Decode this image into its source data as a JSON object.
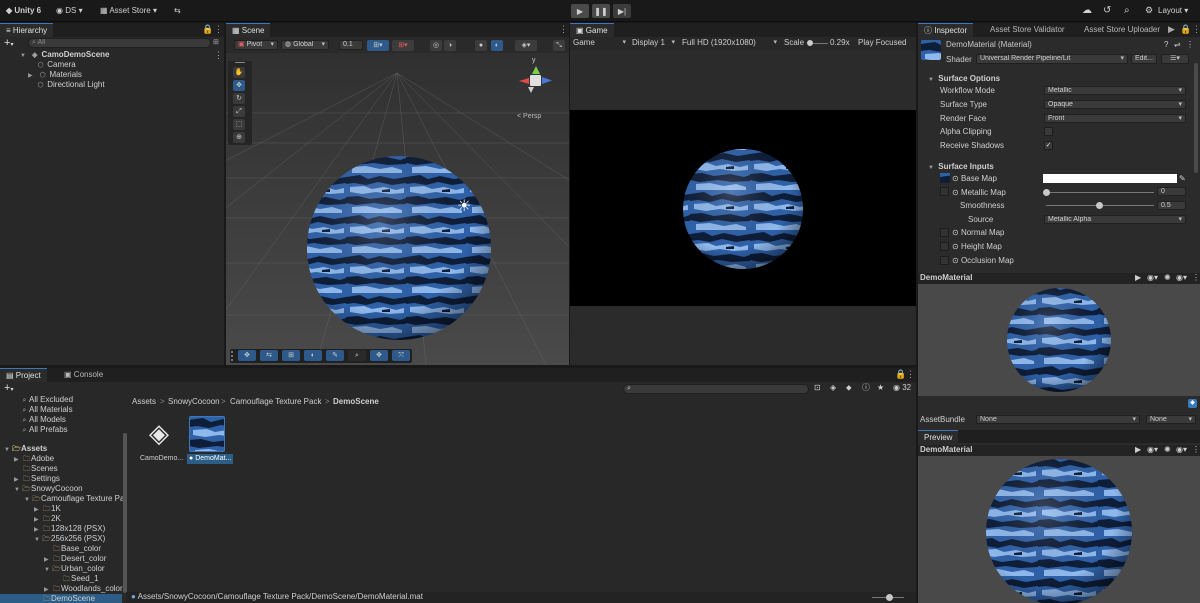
{
  "toolbar": {
    "app": "Unity 6",
    "account": "DS",
    "asset_store": "Asset Store",
    "layout": "Layout"
  },
  "hierarchy": {
    "tab": "Hierarchy",
    "search_placeholder": "All",
    "scene": "CamoDemoScene",
    "items": [
      "Camera",
      "Materials",
      "Directional Light"
    ]
  },
  "scene_view": {
    "tab": "Scene",
    "pivot": "Pivot",
    "global": "Global",
    "snap": "0.1",
    "persp": "< Persp",
    "gizmo_y": "y"
  },
  "game_view": {
    "tab": "Game",
    "mode": "Game",
    "display": "Display 1",
    "resolution": "Full HD (1920x1080)",
    "scale_label": "Scale",
    "scale_value": "0.29x",
    "play_focused": "Play Focused"
  },
  "inspector": {
    "tabs": [
      "Inspector",
      "Asset Store Validator",
      "Asset Store Uploader"
    ],
    "material_name": "DemoMaterial (Material)",
    "shader_label": "Shader",
    "shader_value": "Universal Render Pipeline/Lit",
    "edit_button": "Edit...",
    "surface_options": "Surface Options",
    "workflow_mode_label": "Workflow Mode",
    "workflow_mode_value": "Metallic",
    "surface_type_label": "Surface Type",
    "surface_type_value": "Opaque",
    "render_face_label": "Render Face",
    "render_face_value": "Front",
    "alpha_clipping_label": "Alpha Clipping",
    "receive_shadows_label": "Receive Shadows",
    "surface_inputs": "Surface Inputs",
    "base_map": "Base Map",
    "metallic_map": "Metallic Map",
    "metallic_value": "0",
    "smoothness": "Smoothness",
    "smoothness_value": "0.5",
    "source": "Source",
    "source_value": "Metallic Alpha",
    "normal_map": "Normal Map",
    "height_map": "Height Map",
    "occlusion_map": "Occlusion Map",
    "preview_header": "DemoMaterial",
    "assetbundle_label": "AssetBundle",
    "assetbundle_value": "None",
    "assetbundle_variant": "None",
    "preview_tab": "Preview",
    "preview_title": "DemoMaterial"
  },
  "project": {
    "tabs": [
      "Project",
      "Console"
    ],
    "count": "32",
    "favorites": [
      "All Excluded",
      "All Materials",
      "All Models",
      "All Prefabs"
    ],
    "tree": [
      {
        "label": "Assets",
        "level": 0,
        "open": true,
        "bold": true
      },
      {
        "label": "Adobe",
        "level": 1,
        "open": false
      },
      {
        "label": "Scenes",
        "level": 1,
        "open": null
      },
      {
        "label": "Settings",
        "level": 1,
        "open": false
      },
      {
        "label": "SnowyCocoon",
        "level": 1,
        "open": true
      },
      {
        "label": "Camouflage Texture Pa",
        "level": 2,
        "open": true
      },
      {
        "label": "1K",
        "level": 3,
        "open": false
      },
      {
        "label": "2K",
        "level": 3,
        "open": false
      },
      {
        "label": "128x128 (PSX)",
        "level": 3,
        "open": false
      },
      {
        "label": "256x256 (PSX)",
        "level": 3,
        "open": true
      },
      {
        "label": "Base_color",
        "level": 4,
        "open": null
      },
      {
        "label": "Desert_color",
        "level": 4,
        "open": false
      },
      {
        "label": "Urban_color",
        "level": 4,
        "open": true
      },
      {
        "label": "Seed_1",
        "level": 5,
        "open": null
      },
      {
        "label": "Woodlands_color",
        "level": 4,
        "open": false
      },
      {
        "label": "DemoScene",
        "level": 3,
        "open": null,
        "selected": true
      }
    ],
    "breadcrumb": [
      "Assets",
      "SnowyCocoon",
      "Camouflage Texture Pack",
      "DemoScene"
    ],
    "assets": [
      "CamoDemo...",
      "DemoMat..."
    ],
    "path": "Assets/SnowyCocoon/Camouflage Texture Pack/DemoScene/DemoMaterial.mat"
  },
  "colors": {
    "accent": "#2c5d87",
    "camo_dark": "#0e1d38",
    "camo_mid": "#2f61a8",
    "camo_light": "#8fb8ec"
  }
}
